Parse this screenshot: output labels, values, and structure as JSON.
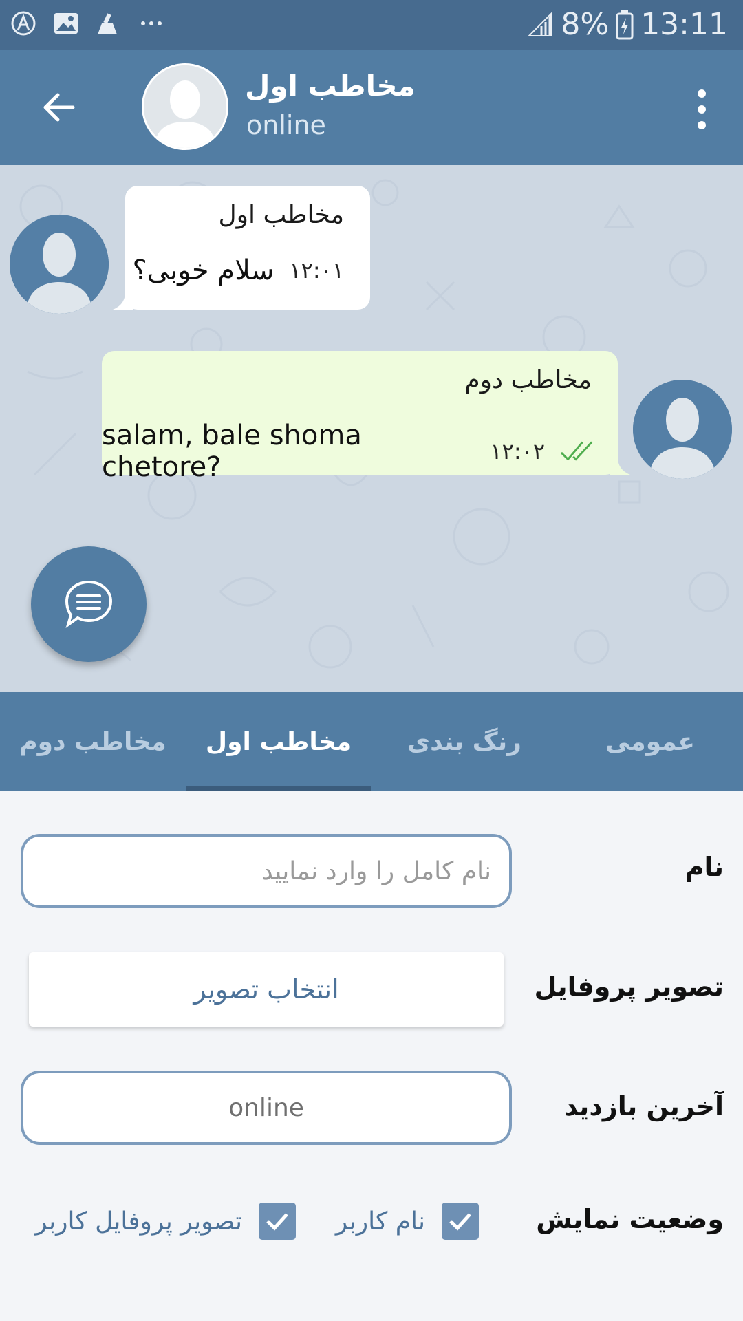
{
  "status_bar": {
    "battery": "8%",
    "time": "13:11",
    "icons": [
      "accessibility-icon",
      "image-icon",
      "cleaner-icon",
      "more-dots-icon",
      "signal-icon",
      "battery-charging-icon"
    ]
  },
  "header": {
    "contact_name": "مخاطب اول",
    "contact_status": "online",
    "back_icon": "arrow-left-icon",
    "menu_icon": "more-vert-icon"
  },
  "chat": {
    "messages": [
      {
        "sender": "مخاطب اول",
        "text": "سلام خوبی؟",
        "time": "۱۲:۰۱",
        "side": "left"
      },
      {
        "sender": "مخاطب دوم",
        "text": "salam, bale shoma chetore?",
        "time": "۱۲:۰۲",
        "side": "right",
        "read": true
      }
    ],
    "fab_icon": "chat-bubble-icon"
  },
  "tabs": [
    {
      "label": "مخاطب دوم",
      "active": false
    },
    {
      "label": "مخاطب اول",
      "active": true
    },
    {
      "label": "رنگ بندی",
      "active": false
    },
    {
      "label": "عمومی",
      "active": false
    }
  ],
  "form": {
    "name_label": "نام",
    "name_value": "",
    "name_placeholder": "نام کامل را وارد نمایید",
    "profile_label": "تصویر پروفایل",
    "profile_button": "انتخاب تصویر",
    "last_seen_label": "آخرین بازدید",
    "last_seen_value": "online",
    "display_label": "وضعیت نمایش",
    "check_username": "نام کاربر",
    "check_username_checked": true,
    "check_profile_pic": "تصویر پروفایل کاربر",
    "check_profile_pic_checked": true
  },
  "colors": {
    "accent": "#527da3",
    "status_bar": "#476b8f",
    "chat_bg": "#cdd7e2",
    "outgoing_bubble": "#effcdd",
    "check_color": "#4fae4e"
  }
}
